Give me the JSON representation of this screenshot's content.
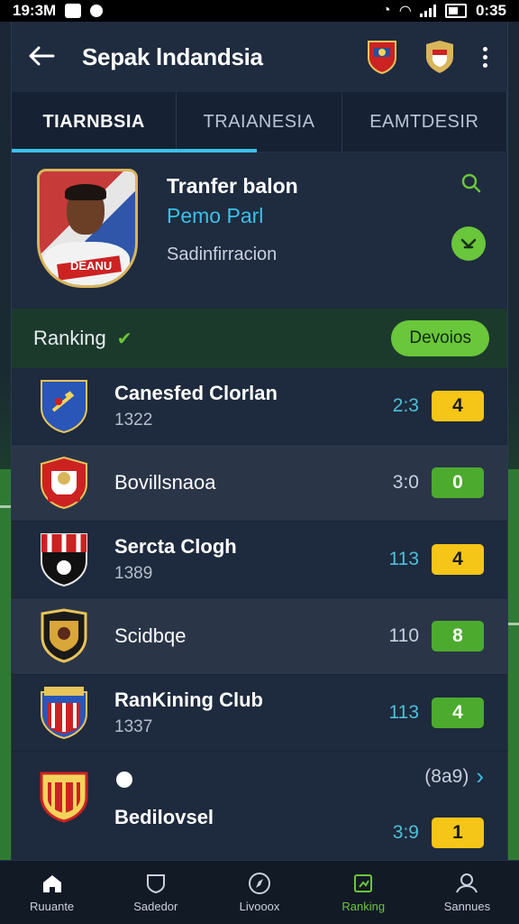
{
  "status_bar": {
    "time": "19:3M",
    "clock": "0:35"
  },
  "app_bar": {
    "title": "Sepak lndandsia"
  },
  "tabs": [
    {
      "label": "TIARNBSIA"
    },
    {
      "label": "TRAIANESIA"
    },
    {
      "label": "EAMTDESIR"
    }
  ],
  "hero": {
    "name": "Tranfer balon",
    "subtitle": "Pemo Parl",
    "meta": "Sadinfirracion",
    "photo_text": "DEANU"
  },
  "ranking": {
    "label": "Ranking",
    "button": "Devoios"
  },
  "clubs": [
    {
      "name": "Canesfed Clorlan",
      "year": "1322",
      "score": "2:3",
      "badge": "4",
      "badge_color": "#f5c518"
    },
    {
      "name": "Bovillsnaoa",
      "year": "",
      "score": "3:0",
      "badge": "0",
      "badge_color": "#4cab2e"
    },
    {
      "name": "Sercta Clogh",
      "year": "1389",
      "score": "113",
      "badge": "4",
      "badge_color": "#f5c518"
    },
    {
      "name": "Scidbqe",
      "year": "",
      "score": "110",
      "badge": "8",
      "badge_color": "#4cab2e"
    },
    {
      "name": "RanKining Club",
      "year": "1337",
      "score": "113",
      "badge": "4",
      "badge_color": "#4cab2e"
    },
    {
      "name": "Bedilovsel",
      "year": "",
      "score": "(8a9)",
      "score2": "3:9",
      "badge": "1",
      "badge_color": "#f5c518"
    }
  ],
  "nav": [
    {
      "label": "Ruuante",
      "icon": "home-icon"
    },
    {
      "label": "Sadedor",
      "icon": "shield-outline-icon"
    },
    {
      "label": "Livooox",
      "icon": "compass-icon"
    },
    {
      "label": "Ranking",
      "icon": "ranking-icon"
    },
    {
      "label": "Sannues",
      "icon": "profile-icon"
    }
  ],
  "colors": {
    "accent_cyan": "#3bc0e8",
    "accent_green": "#6ac63a",
    "panel": "#1e2a3d"
  }
}
